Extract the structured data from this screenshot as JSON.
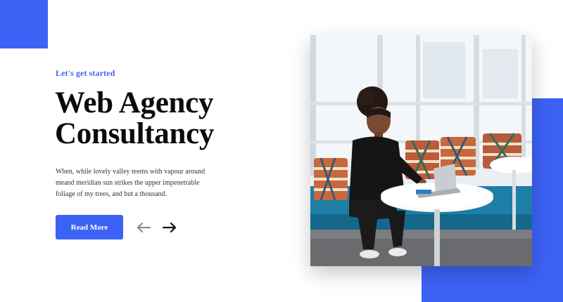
{
  "hero": {
    "eyebrow": "Let's get started",
    "title_line1": "Web Agency",
    "title_line2": "Consultancy",
    "description": "When, while lovely valley teems with vapour around meand meridian sun strikes the upper impenetrable foliage of my trees, and but a thousand.",
    "cta_label": "Read More"
  },
  "slider": {
    "prev_icon": "arrow-left-icon",
    "next_icon": "arrow-right-icon"
  },
  "image": {
    "subject": "woman-working-on-laptop-photo"
  },
  "colors": {
    "accent": "#3c62f5",
    "title": "#0b0b0b",
    "text": "#333333"
  }
}
